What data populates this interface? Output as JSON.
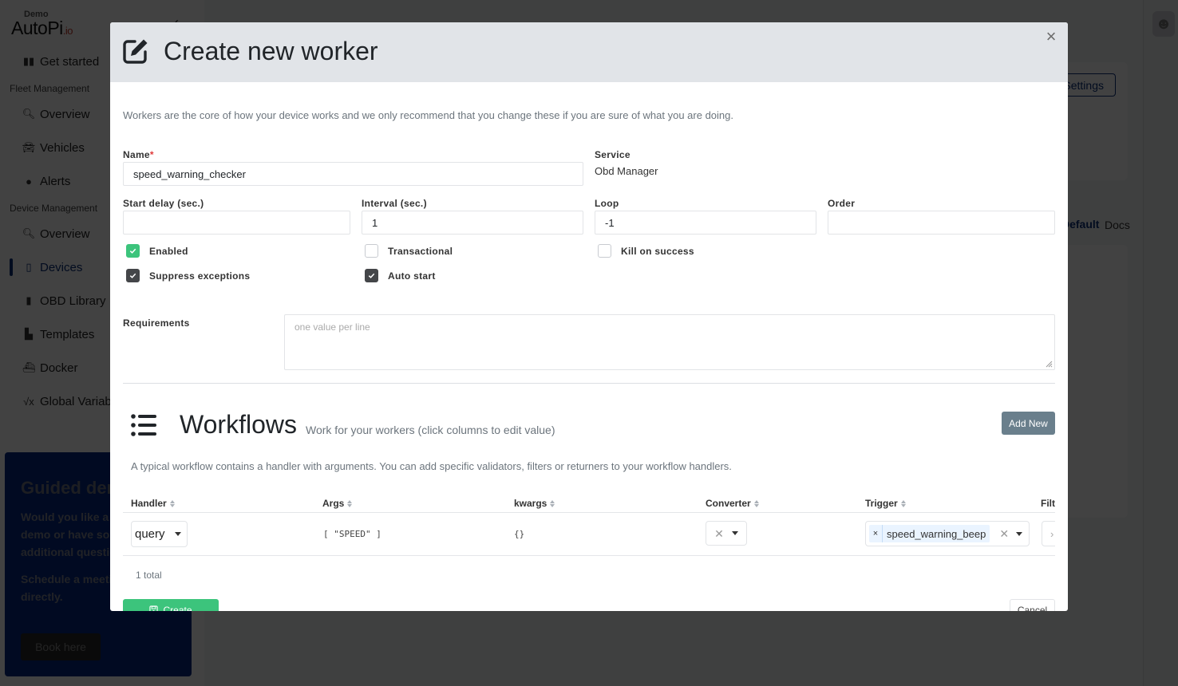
{
  "app": {
    "logo_demo": "Demo",
    "logo_brand": "AutoPi",
    "logo_suffix": ".io"
  },
  "sidebar": {
    "get_started": "Get started",
    "sections": [
      {
        "title": "Fleet Management",
        "items": [
          {
            "label": "Overview",
            "icon": "analytics-search-icon"
          },
          {
            "label": "Vehicles",
            "icon": "car-icon"
          },
          {
            "label": "Alerts",
            "icon": "alert-icon"
          }
        ]
      },
      {
        "title": "Device Management",
        "items": [
          {
            "label": "Overview",
            "icon": "analytics-search-icon"
          },
          {
            "label": "Devices",
            "icon": "devices-icon",
            "active": true
          },
          {
            "label": "OBD Library",
            "icon": "book-icon"
          },
          {
            "label": "Templates",
            "icon": "templates-icon"
          },
          {
            "label": "Docker",
            "icon": "docker-icon"
          },
          {
            "label": "Global Variables",
            "icon": "sqrt-x-icon"
          }
        ]
      }
    ]
  },
  "guided_demo": {
    "title": "Guided demo",
    "text1": "Would you like a guided demo or have some additional questions?",
    "text2": "Schedule a meeting with us directly.",
    "button": "Book here"
  },
  "background": {
    "settings_button": "Settings",
    "tab_default": "Default",
    "tab_docs": "Docs"
  },
  "modal": {
    "title": "Create new worker",
    "intro": "Workers are the core of how your device works and we only recommend that you change these if you are sure of what you are doing.",
    "fields": {
      "name_label": "Name",
      "name_required": "*",
      "name_value": "speed_warning_checker",
      "service_label": "Service",
      "service_value": "Obd Manager",
      "start_delay_label": "Start delay (sec.)",
      "start_delay_value": "",
      "interval_label": "Interval (sec.)",
      "interval_value": "1",
      "loop_label": "Loop",
      "loop_value": "-1",
      "order_label": "Order",
      "order_value": ""
    },
    "checkboxes": {
      "enabled": {
        "label": "Enabled",
        "checked": true
      },
      "transactional": {
        "label": "Transactional",
        "checked": false
      },
      "kill_on_success": {
        "label": "Kill on success",
        "checked": false
      },
      "suppress_exceptions": {
        "label": "Suppress exceptions",
        "checked": true
      },
      "auto_start": {
        "label": "Auto start",
        "checked": true
      }
    },
    "requirements": {
      "label": "Requirements",
      "placeholder": "one value per line",
      "value": ""
    },
    "workflows": {
      "title": "Workflows",
      "subtitle": "Work for your workers (click columns to edit value)",
      "add_new": "Add New",
      "description": "A typical workflow contains a handler with arguments. You can add specific validators, filters or returners to your workflow handlers.",
      "columns": [
        "Handler",
        "Args",
        "kwargs",
        "Converter",
        "Trigger",
        "Filt"
      ],
      "rows": [
        {
          "handler": "query",
          "args": "[ \"SPEED\" ]",
          "kwargs": "{}",
          "converter": "",
          "trigger": "speed_warning_beep"
        }
      ],
      "total": "1 total"
    },
    "create_button": "Create",
    "cancel_button": "Cancel"
  },
  "colors": {
    "primary_green": "#3cc47c",
    "brand_navy": "#0b2f7a",
    "add_new_gray": "#6a7f8c"
  }
}
